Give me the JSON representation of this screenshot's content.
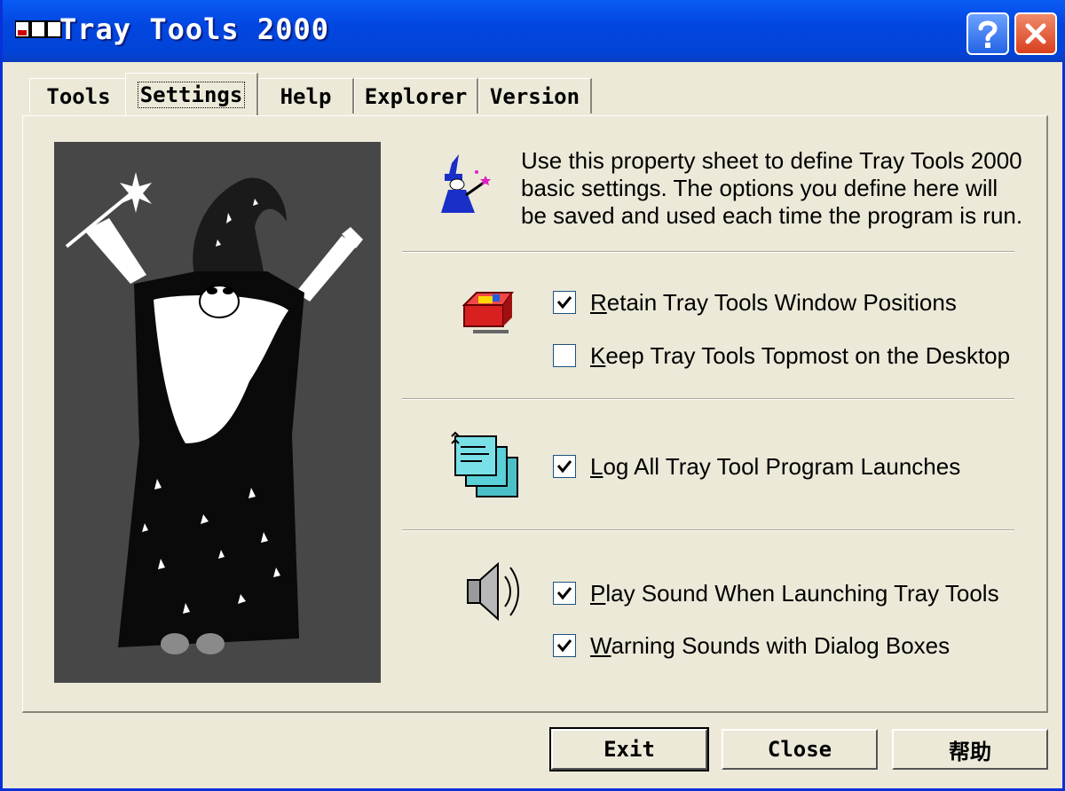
{
  "window": {
    "title": "Tray Tools 2000"
  },
  "tabs": [
    {
      "label": "Tools",
      "active": false
    },
    {
      "label": "Settings",
      "active": true
    },
    {
      "label": "Help",
      "active": false
    },
    {
      "label": "Explorer",
      "active": false
    },
    {
      "label": "Version",
      "active": false
    }
  ],
  "description": "Use this property sheet to define Tray Tools 2000 basic settings. The options you define here will be saved and used each time the program is run.",
  "options": [
    {
      "mnemonic": "R",
      "rest": "etain Tray Tools Window Positions",
      "checked": true
    },
    {
      "mnemonic": "K",
      "rest": "eep Tray Tools Topmost on the Desktop",
      "checked": false
    },
    {
      "mnemonic": "L",
      "rest": "og All Tray Tool Program Launches",
      "checked": true
    },
    {
      "mnemonic": "P",
      "rest": "lay Sound When Launching Tray Tools",
      "checked": true
    },
    {
      "mnemonic": "W",
      "rest": "arning Sounds with Dialog Boxes",
      "checked": true
    }
  ],
  "buttons": {
    "exit": "Exit",
    "close": "Close",
    "help": "帮助"
  },
  "icons": {
    "app": "app-icon",
    "wizard_small": "wizard-icon",
    "toolbox": "toolbox-icon",
    "log": "log-notes-icon",
    "speaker": "speaker-icon",
    "window_help": "question-icon",
    "window_close": "close-icon"
  },
  "colors": {
    "titlebar": "#0246e0",
    "dialog_bg": "#ece9d8",
    "wizard_panel": "#474747"
  }
}
